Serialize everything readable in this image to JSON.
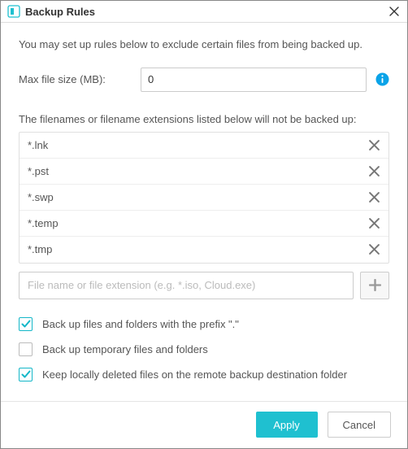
{
  "window": {
    "title": "Backup Rules"
  },
  "intro": "You may set up rules below to exclude certain files from being backed up.",
  "filesize": {
    "label": "Max file size (MB):",
    "value": "0"
  },
  "exclude": {
    "heading": "The filenames or filename extensions listed below will not be backed up:",
    "items": [
      {
        "pattern": "*.lnk"
      },
      {
        "pattern": "*.pst"
      },
      {
        "pattern": "*.swp"
      },
      {
        "pattern": "*.temp"
      },
      {
        "pattern": "*.tmp"
      }
    ],
    "add_placeholder": "File name or file extension (e.g. *.iso, Cloud.exe)"
  },
  "options": {
    "backup_prefix_dot": {
      "label": "Back up files and folders with the prefix \".\"",
      "checked": true
    },
    "backup_temp": {
      "label": "Back up temporary files and folders",
      "checked": false
    },
    "keep_deleted_remote": {
      "label": "Keep locally deleted files on the remote backup destination folder",
      "checked": true
    }
  },
  "buttons": {
    "apply": "Apply",
    "cancel": "Cancel"
  },
  "colors": {
    "accent": "#1fc0d0",
    "info": "#0aa3e8"
  }
}
